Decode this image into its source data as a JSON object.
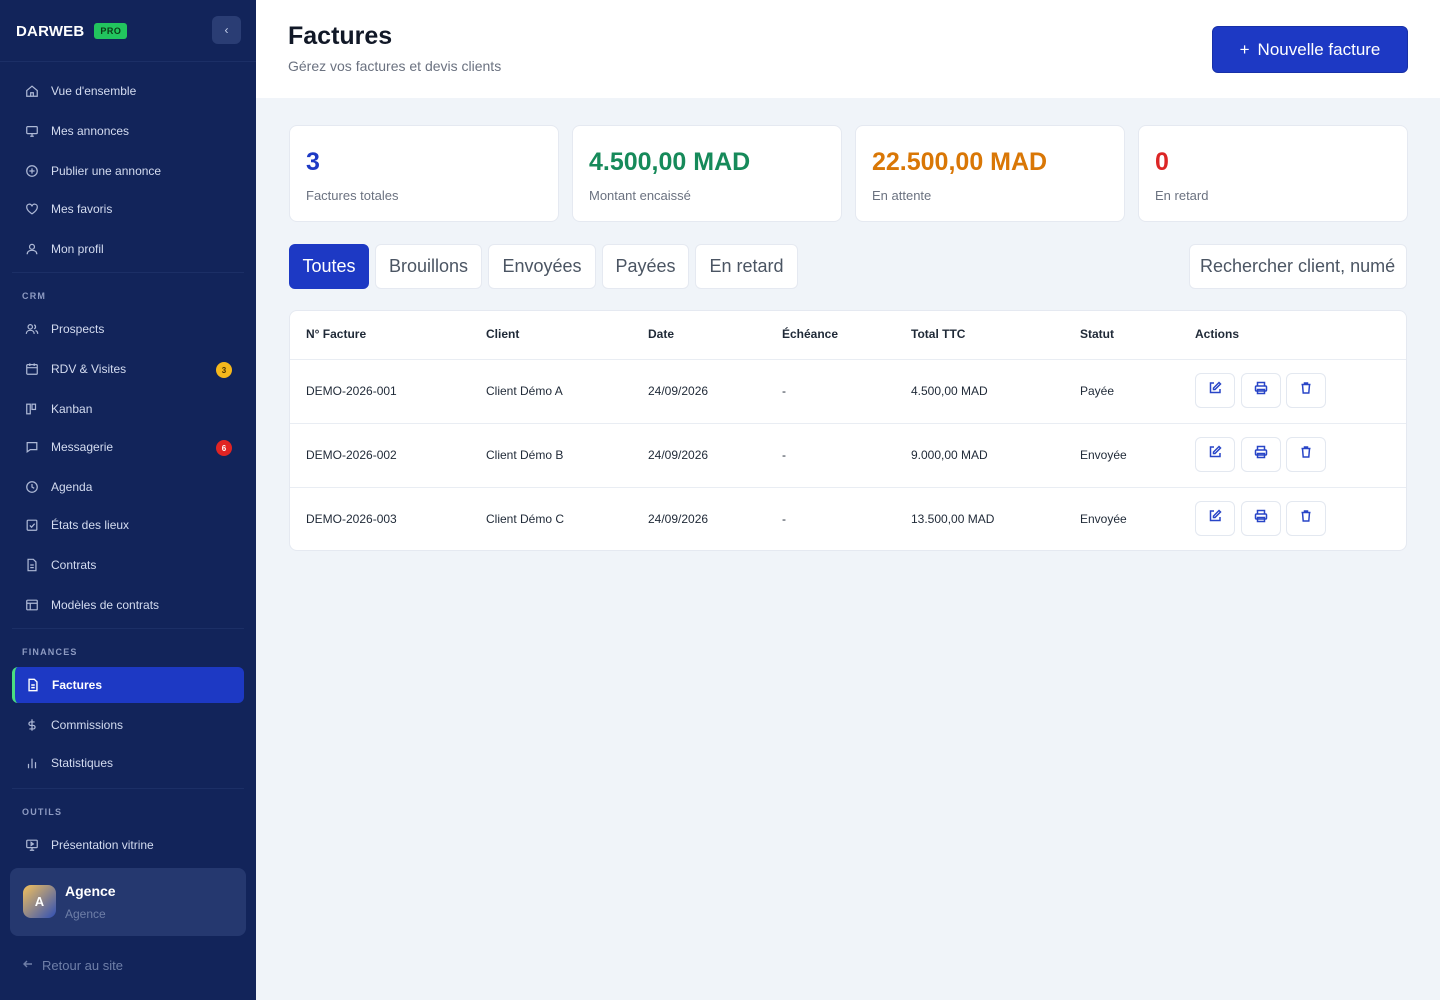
{
  "brand": {
    "name": "DARWEB",
    "badge": "PRO"
  },
  "sidebar": {
    "collapse_glyph": "‹",
    "items": [
      {
        "label": "Vue d'ensemble",
        "icon": "home-icon"
      },
      {
        "label": "Mes annonces",
        "icon": "monitor-icon"
      },
      {
        "label": "Publier une annonce",
        "icon": "plus-circle-icon"
      },
      {
        "label": "Mes favoris",
        "icon": "heart-icon"
      },
      {
        "label": "Mon profil",
        "icon": "user-icon"
      }
    ],
    "crm_label": "CRM",
    "crm_items": [
      {
        "label": "Prospects",
        "icon": "users-icon"
      },
      {
        "label": "RDV & Visites",
        "icon": "calendar-icon",
        "badge": "3"
      },
      {
        "label": "Kanban",
        "icon": "kanban-icon"
      },
      {
        "label": "Messagerie",
        "icon": "chat-icon",
        "badge": "6"
      },
      {
        "label": "Agenda",
        "icon": "clock-icon"
      },
      {
        "label": "États des lieux",
        "icon": "clipboard-check-icon"
      },
      {
        "label": "Contrats",
        "icon": "document-icon"
      },
      {
        "label": "Modèles de contrats",
        "icon": "template-icon"
      }
    ],
    "finances_label": "FINANCES",
    "finances_items": [
      {
        "label": "Factures",
        "icon": "invoice-icon",
        "active": true
      },
      {
        "label": "Commissions",
        "icon": "dollar-icon"
      },
      {
        "label": "Statistiques",
        "icon": "bar-chart-icon"
      }
    ],
    "tools_label": "OUTILS",
    "tools_items": [
      {
        "label": "Présentation vitrine",
        "icon": "presentation-icon"
      }
    ],
    "user": {
      "initial": "A",
      "name": "Agence",
      "role": "Agence"
    },
    "back_link": "Retour au site"
  },
  "header": {
    "title": "Factures",
    "subtitle": "Gérez vos factures et devis clients",
    "new_button": "Nouvelle facture",
    "new_button_glyph": "+"
  },
  "stats": [
    {
      "value": "3",
      "label": "Factures totales",
      "color": "#1d39c4"
    },
    {
      "value": "4.500,00 MAD",
      "label": "Montant encaissé",
      "color": "#168a5a"
    },
    {
      "value": "22.500,00 MAD",
      "label": "En attente",
      "color": "#d97706"
    },
    {
      "value": "0",
      "label": "En retard",
      "color": "#dc2626"
    }
  ],
  "tabs": [
    "Toutes",
    "Brouillons",
    "Envoyées",
    "Payées",
    "En retard"
  ],
  "search": {
    "placeholder": "Rechercher client, numéro..."
  },
  "table": {
    "headers": [
      "N° Facture",
      "Client",
      "Date",
      "Échéance",
      "Total TTC",
      "Statut",
      "Actions"
    ],
    "rows": [
      [
        "DEMO-2026-001",
        "Client Démo A",
        "24/09/2026",
        "-",
        "4.500,00 MAD",
        "Payée"
      ],
      [
        "DEMO-2026-002",
        "Client Démo B",
        "24/09/2026",
        "-",
        "9.000,00 MAD",
        "Envoyée"
      ],
      [
        "DEMO-2026-003",
        "Client Démo C",
        "24/09/2026",
        "-",
        "13.500,00 MAD",
        "Envoyée"
      ]
    ],
    "action_icons": [
      "edit-icon",
      "print-icon",
      "delete-icon"
    ]
  },
  "colors": {
    "sidebar_bg": "#12245a",
    "accent": "#1d39c4",
    "active_marker": "#4ade80",
    "page_bg": "#f0f4f9"
  }
}
